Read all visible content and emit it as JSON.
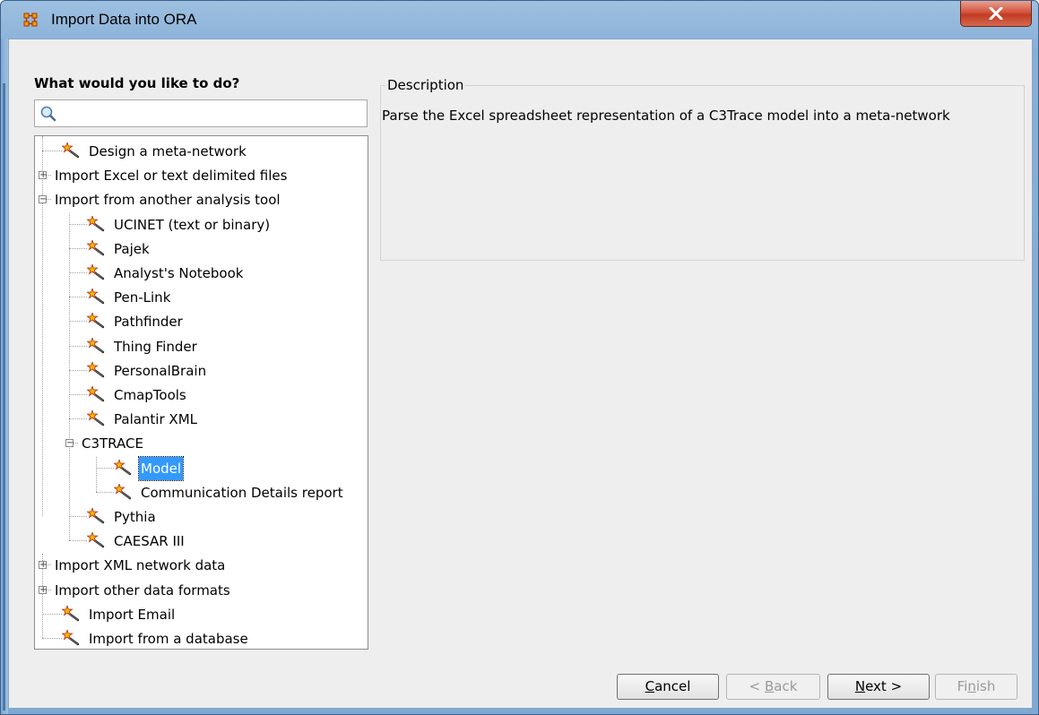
{
  "window": {
    "title": "Import Data into ORA",
    "app_icon": "ora-network-icon",
    "close_icon": "close-icon"
  },
  "left_panel": {
    "prompt": "What would you like to do?",
    "search": {
      "value": "",
      "icon": "search-icon"
    }
  },
  "tree": {
    "items": [
      {
        "label": "Design a meta-network",
        "icon": "wizard-wand-icon"
      },
      {
        "label": "Import Excel or text delimited files",
        "expander": "+"
      },
      {
        "label": "Import from another analysis tool",
        "expander": "-"
      },
      {
        "label": "UCINET (text or binary)",
        "icon": "wizard-wand-icon"
      },
      {
        "label": "Pajek",
        "icon": "wizard-wand-icon"
      },
      {
        "label": "Analyst's Notebook",
        "icon": "wizard-wand-icon"
      },
      {
        "label": "Pen-Link",
        "icon": "wizard-wand-icon"
      },
      {
        "label": "Pathfinder",
        "icon": "wizard-wand-icon"
      },
      {
        "label": "Thing Finder",
        "icon": "wizard-wand-icon"
      },
      {
        "label": "PersonalBrain",
        "icon": "wizard-wand-icon"
      },
      {
        "label": "CmapTools",
        "icon": "wizard-wand-icon"
      },
      {
        "label": "Palantir XML",
        "icon": "wizard-wand-icon"
      },
      {
        "label": "C3TRACE",
        "expander": "-"
      },
      {
        "label": "Model",
        "icon": "wizard-wand-icon",
        "selected": true
      },
      {
        "label": "Communication Details report",
        "icon": "wizard-wand-icon"
      },
      {
        "label": "Pythia",
        "icon": "wizard-wand-icon"
      },
      {
        "label": "CAESAR III",
        "icon": "wizard-wand-icon"
      },
      {
        "label": "Import XML network data",
        "expander": "+"
      },
      {
        "label": "Import other data formats",
        "expander": "+"
      },
      {
        "label": "Import Email",
        "icon": "wizard-wand-icon"
      },
      {
        "label": "Import from a database",
        "icon": "wizard-wand-icon"
      }
    ]
  },
  "description": {
    "title": "Description",
    "text": "Parse the Excel spreadsheet representation of a C3Trace model into a meta-network"
  },
  "buttons": {
    "cancel": {
      "label": "Cancel",
      "mnemonic": "C",
      "rest": "ancel",
      "enabled": true
    },
    "back": {
      "label": "< Back",
      "pre": "< ",
      "mnemonic": "B",
      "rest": "ack",
      "enabled": false
    },
    "next": {
      "label": "Next >",
      "mnemonic": "N",
      "rest": "ext >",
      "enabled": true
    },
    "finish": {
      "label": "Finish",
      "pre": "Fi",
      "mnemonic": "n",
      "rest": "ish",
      "enabled": false
    }
  },
  "colors": {
    "selection": "#3399ff",
    "titlebar": "#9ec0e0",
    "close": "#c23a22"
  }
}
